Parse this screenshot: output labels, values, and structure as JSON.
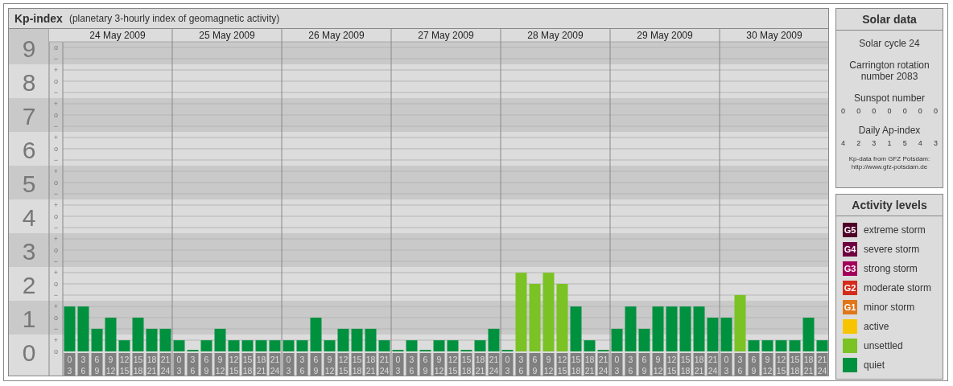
{
  "main": {
    "title": "Kp-index",
    "subtitle": "(planetary 3-hourly index of geomagnetic activity)",
    "sub_ticks": [
      "o",
      "−",
      "+",
      "o",
      "−",
      "+",
      "o",
      "−",
      "+",
      "o",
      "−",
      "+",
      "o",
      "−",
      "+",
      "o",
      "−",
      "+",
      "o",
      "−",
      "+",
      "o",
      "−",
      "+",
      "o",
      "−",
      "+",
      "o"
    ],
    "days": [
      {
        "date": "24 May 2009",
        "slots": [
          {
            "start": "0",
            "end": "3"
          },
          {
            "start": "3",
            "end": "6"
          },
          {
            "start": "6",
            "end": "9"
          },
          {
            "start": "9",
            "end": "12"
          },
          {
            "start": "12",
            "end": "15"
          },
          {
            "start": "15",
            "end": "18"
          },
          {
            "start": "18",
            "end": "21"
          },
          {
            "start": "21",
            "end": "24"
          }
        ]
      },
      {
        "date": "25 May 2009",
        "slots": [
          {
            "start": "0",
            "end": "3"
          },
          {
            "start": "3",
            "end": "6"
          },
          {
            "start": "6",
            "end": "9"
          },
          {
            "start": "9",
            "end": "12"
          },
          {
            "start": "12",
            "end": "15"
          },
          {
            "start": "15",
            "end": "18"
          },
          {
            "start": "18",
            "end": "21"
          },
          {
            "start": "21",
            "end": "24"
          }
        ]
      },
      {
        "date": "26 May 2009",
        "slots": [
          {
            "start": "0",
            "end": "3"
          },
          {
            "start": "3",
            "end": "6"
          },
          {
            "start": "6",
            "end": "9"
          },
          {
            "start": "9",
            "end": "12"
          },
          {
            "start": "12",
            "end": "15"
          },
          {
            "start": "15",
            "end": "18"
          },
          {
            "start": "18",
            "end": "21"
          },
          {
            "start": "21",
            "end": "24"
          }
        ]
      },
      {
        "date": "27 May 2009",
        "slots": [
          {
            "start": "0",
            "end": "3"
          },
          {
            "start": "3",
            "end": "6"
          },
          {
            "start": "6",
            "end": "9"
          },
          {
            "start": "9",
            "end": "12"
          },
          {
            "start": "12",
            "end": "15"
          },
          {
            "start": "15",
            "end": "18"
          },
          {
            "start": "18",
            "end": "21"
          },
          {
            "start": "21",
            "end": "24"
          }
        ]
      },
      {
        "date": "28 May 2009",
        "slots": [
          {
            "start": "0",
            "end": "3"
          },
          {
            "start": "3",
            "end": "6"
          },
          {
            "start": "6",
            "end": "9"
          },
          {
            "start": "9",
            "end": "12"
          },
          {
            "start": "12",
            "end": "15"
          },
          {
            "start": "15",
            "end": "18"
          },
          {
            "start": "18",
            "end": "21"
          },
          {
            "start": "21",
            "end": "24"
          }
        ]
      },
      {
        "date": "29 May 2009",
        "slots": [
          {
            "start": "0",
            "end": "3"
          },
          {
            "start": "3",
            "end": "6"
          },
          {
            "start": "6",
            "end": "9"
          },
          {
            "start": "9",
            "end": "12"
          },
          {
            "start": "12",
            "end": "15"
          },
          {
            "start": "15",
            "end": "18"
          },
          {
            "start": "18",
            "end": "21"
          },
          {
            "start": "21",
            "end": "24"
          }
        ]
      },
      {
        "date": "30 May 2009",
        "slots": [
          {
            "start": "0",
            "end": "3"
          },
          {
            "start": "3",
            "end": "6"
          },
          {
            "start": "6",
            "end": "9"
          },
          {
            "start": "9",
            "end": "12"
          },
          {
            "start": "12",
            "end": "15"
          },
          {
            "start": "15",
            "end": "18"
          },
          {
            "start": "18",
            "end": "21"
          },
          {
            "start": "21",
            "end": "24"
          }
        ]
      }
    ],
    "chart_data": {
      "type": "bar",
      "ylim": [
        0,
        9
      ],
      "yticks": [
        0,
        1,
        2,
        3,
        4,
        5,
        6,
        7,
        8,
        9
      ],
      "grid": true,
      "series": [
        {
          "color": "#00913f",
          "values": [
            1.33,
            1.33,
            0.67,
            1,
            0.33,
            1,
            0.67,
            0.67,
            0.33,
            0,
            0.33,
            0.67,
            0.33,
            0.33,
            0.33,
            0.33,
            0.33,
            0.33,
            1,
            0.33,
            0.67,
            0.67,
            0.67,
            0.33,
            0,
            0.33,
            0,
            0.33,
            0.33,
            0,
            0.33,
            0.67,
            0,
            null,
            null,
            null,
            null,
            1.33,
            0.33,
            0,
            0.67,
            1.33,
            0.67,
            1.33,
            1.33,
            1.33,
            1.33,
            1,
            1,
            null,
            0.33,
            0.33,
            0.33,
            0.33,
            1,
            0.33
          ]
        },
        {
          "color": "#7bc224",
          "values": [
            null,
            null,
            null,
            null,
            null,
            null,
            null,
            null,
            null,
            null,
            null,
            null,
            null,
            null,
            null,
            null,
            null,
            null,
            null,
            null,
            null,
            null,
            null,
            null,
            null,
            null,
            null,
            null,
            null,
            null,
            null,
            null,
            null,
            2.33,
            2,
            2.33,
            2,
            null,
            null,
            null,
            null,
            null,
            null,
            null,
            null,
            null,
            null,
            null,
            null,
            1.67,
            null,
            null,
            null,
            null,
            null,
            null
          ]
        }
      ]
    }
  },
  "solar": {
    "title": "Solar data",
    "cycle": "Solar cycle 24",
    "rotation": "Carrington rotation number 2083",
    "sunspot_title": "Sunspot number",
    "sunspots": [
      "0",
      "0",
      "0",
      "0",
      "0",
      "0",
      "0"
    ],
    "ap_title": "Daily Ap-index",
    "ap_values": [
      "4",
      "2",
      "3",
      "1",
      "5",
      "4",
      "3"
    ],
    "source": "Kp-data from GFZ Potsdam:",
    "source_url": "http://www.gfz-potsdam.de"
  },
  "legend": {
    "title": "Activity levels",
    "items": [
      {
        "badge": "G5",
        "label": "extreme storm",
        "color": "#4e0026"
      },
      {
        "badge": "G4",
        "label": "severe storm",
        "color": "#6e0040"
      },
      {
        "badge": "G3",
        "label": "strong storm",
        "color": "#a3005c"
      },
      {
        "badge": "G2",
        "label": "moderate storm",
        "color": "#d52b1b"
      },
      {
        "badge": "G1",
        "label": "minor storm",
        "color": "#e0761a"
      },
      {
        "label": "active",
        "color": "#f8c400"
      },
      {
        "label": "unsettled",
        "color": "#7bc224"
      },
      {
        "label": "quiet",
        "color": "#00913f"
      }
    ]
  }
}
